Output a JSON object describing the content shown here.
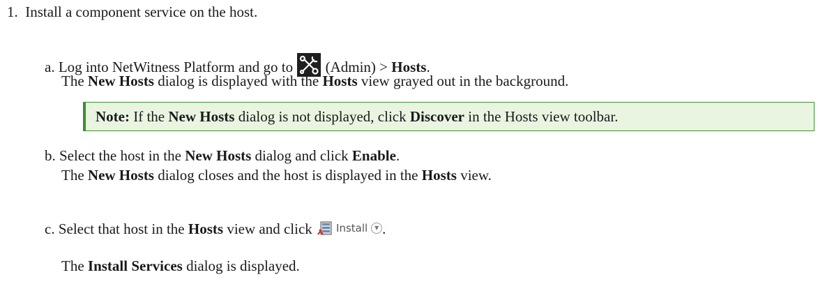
{
  "step1": {
    "number": "1.",
    "text": "Install a component service on the host."
  },
  "step_a": {
    "letter": "a.",
    "t1": "Log into NetWitness Platform and go to ",
    "t2": " (Admin) > ",
    "b1": "Hosts",
    "t3": ".",
    "line2": {
      "b1": "New Hosts",
      "t1": " dialog is displayed with the ",
      "b2": "Hosts",
      "t2": " view grayed out in the background.",
      "p0": "The "
    }
  },
  "note": {
    "label": "Note:",
    "t1": " If the ",
    "b1": "New Hosts",
    "t2": " dialog is not displayed, click ",
    "b2": "Discover",
    "t3": " in the Hosts view toolbar."
  },
  "step_b": {
    "letter": "b.",
    "t1": "Select the host in the ",
    "b1": "New Hosts",
    "t2": " dialog and click ",
    "b2": "Enable",
    "t3": ".",
    "line2": {
      "p0": "The ",
      "b1": "New Hosts",
      "t1": " dialog closes and the host is displayed in the ",
      "b2": "Hosts",
      "t2": " view."
    }
  },
  "step_c": {
    "letter": "c.",
    "t1": "Select that host in the ",
    "b1": "Hosts",
    "t2": " view and click ",
    "install_label": "Install",
    "t3": ".",
    "line2": {
      "p0": "The ",
      "b1": "Install Services",
      "t1": " dialog is displayed."
    }
  },
  "icons": {
    "admin": "admin-tools-icon",
    "install": "server-install-icon",
    "dropdown": "chevron-down-circle-icon"
  },
  "colors": {
    "note_bg": "#e9f5e1",
    "note_border": "#3d8f2f",
    "admin_icon_bg": "#1f1f1f"
  }
}
